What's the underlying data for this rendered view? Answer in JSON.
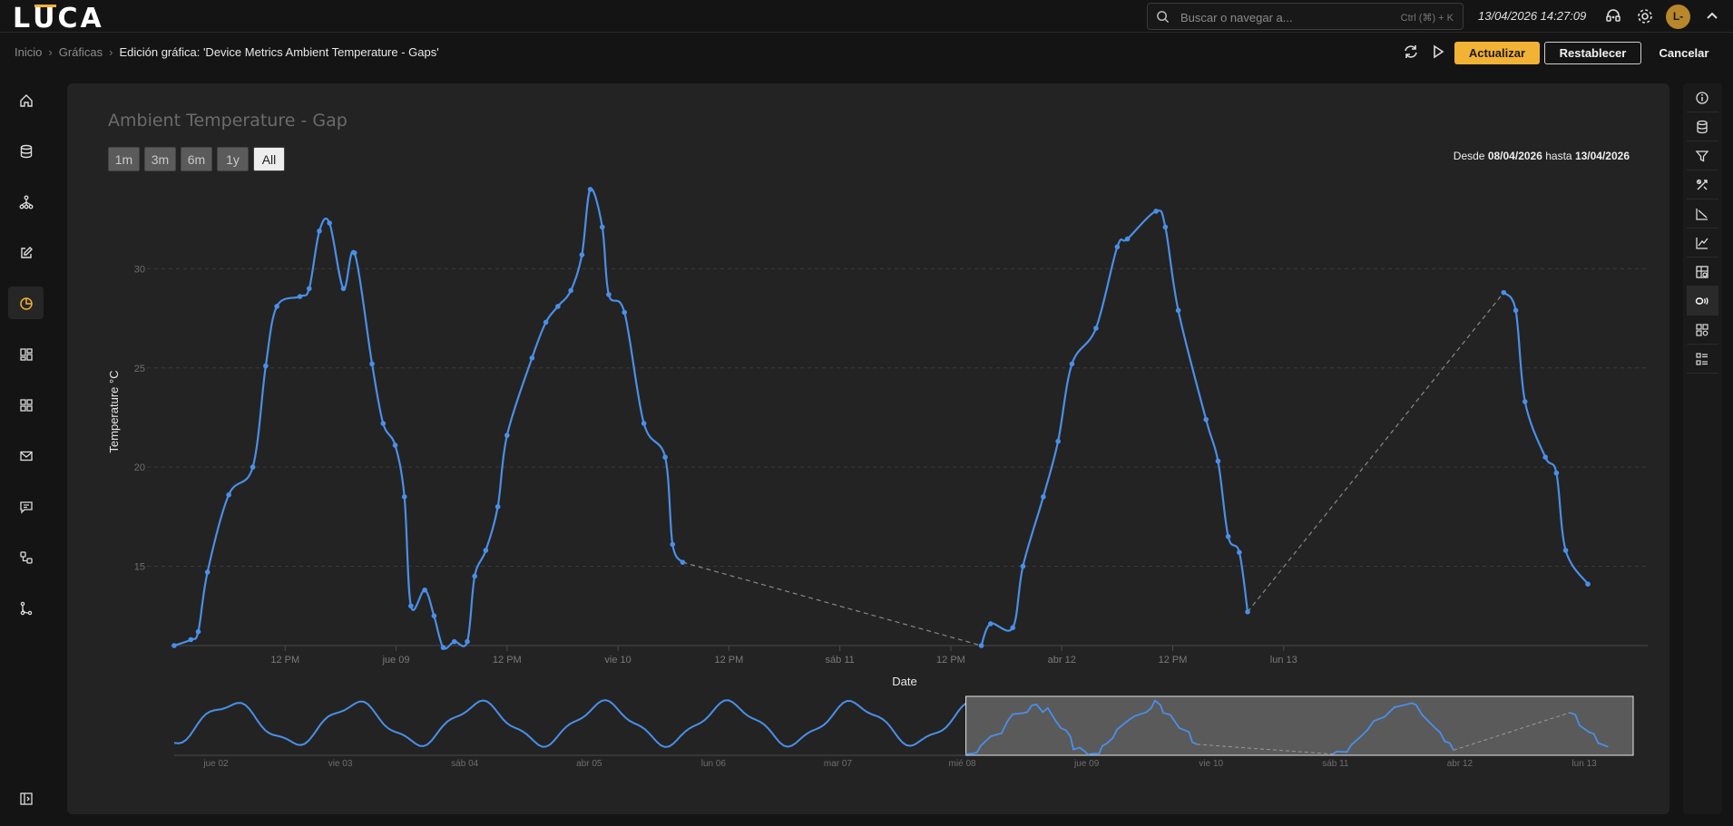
{
  "app": {
    "logo": "LUCA"
  },
  "search": {
    "placeholder": "Buscar o navegar a...",
    "shortcut": "Ctrl (⌘) + K"
  },
  "header": {
    "datetime": "13/04/2026 14:27:09",
    "avatar_initials": "L-"
  },
  "breadcrumb": {
    "items": [
      "Inicio",
      "Gráficas"
    ],
    "current": "Edición gráfica: 'Device Metrics Ambient Temperature - Gaps'"
  },
  "toolbar": {
    "update_label": "Actualizar",
    "reset_label": "Restablecer",
    "cancel_label": "Cancelar"
  },
  "sidebar": {
    "icons": [
      "home-icon",
      "database-icon",
      "network-icon",
      "edit-icon",
      "chart-pie-icon",
      "dashboard-icon",
      "grid-icon",
      "mail-icon",
      "chat-icon",
      "workflow-icon",
      "branch-icon"
    ],
    "active_index": 4,
    "footer_icon": "collapse-sidebar-icon"
  },
  "rightbar": {
    "icons": [
      "info-icon",
      "database-icon",
      "filter-icon",
      "tools-icon",
      "axis-icon",
      "line-chart-icon",
      "chart-search-icon",
      "labels-icon",
      "chart-settings-icon",
      "list-icon"
    ],
    "active_index": 7
  },
  "chart": {
    "title": "Ambient Temperature - Gap",
    "range_buttons": [
      "1m",
      "3m",
      "6m",
      "1y",
      "All"
    ],
    "selected_range": "All",
    "range_from_label": "Desde",
    "range_from": "08/04/2026",
    "range_to_label": "hasta",
    "range_to": "13/04/2026",
    "line_color": "#4a8fe8",
    "gap_color": "#888888"
  },
  "chart_data": {
    "type": "line",
    "title": "Ambient Temperature - Gap",
    "xlabel": "Date",
    "ylabel": "Temperature °C",
    "ylim": [
      11,
      35
    ],
    "y_ticks": [
      15,
      20,
      25,
      30
    ],
    "x_ticks": [
      "12 PM",
      "jue 09",
      "12 PM",
      "vie 10",
      "12 PM",
      "sáb 11",
      "12 PM",
      "abr 12",
      "12 PM",
      "lun 13"
    ],
    "grid": true,
    "legend": "none",
    "x_unit": "hours since 2026-04-08 00:00",
    "series": [
      {
        "name": "Ambient Temperature",
        "points": [
          [
            0.0,
            11.0
          ],
          [
            1.8,
            11.3
          ],
          [
            2.6,
            11.7
          ],
          [
            3.6,
            14.7
          ],
          [
            5.9,
            18.6
          ],
          [
            8.5,
            20.0
          ],
          [
            9.9,
            25.1
          ],
          [
            11.1,
            28.1
          ],
          [
            13.6,
            28.6
          ],
          [
            14.6,
            29.0
          ],
          [
            15.7,
            31.9
          ],
          [
            16.8,
            32.3
          ],
          [
            18.3,
            29.0
          ],
          [
            19.5,
            30.8
          ],
          [
            21.4,
            25.2
          ],
          [
            22.6,
            22.2
          ],
          [
            23.9,
            21.1
          ],
          [
            24.9,
            18.5
          ],
          [
            25.6,
            13.0
          ],
          [
            27.1,
            13.8
          ],
          [
            28.1,
            12.5
          ],
          [
            29.1,
            10.9
          ],
          [
            30.3,
            11.2
          ],
          [
            31.7,
            11.2
          ],
          [
            32.5,
            14.5
          ],
          [
            33.7,
            15.8
          ],
          [
            35.0,
            18.0
          ],
          [
            36.0,
            21.6
          ],
          [
            38.7,
            25.5
          ],
          [
            40.2,
            27.3
          ],
          [
            41.5,
            28.1
          ],
          [
            42.9,
            28.9
          ],
          [
            44.1,
            30.7
          ],
          [
            45.0,
            34.0
          ],
          [
            46.3,
            32.1
          ],
          [
            47.0,
            28.7
          ],
          [
            48.7,
            27.8
          ],
          [
            50.8,
            22.2
          ],
          [
            53.1,
            20.5
          ],
          [
            53.9,
            16.1
          ],
          [
            55.0,
            15.2
          ]
        ],
        "gap_after_index": 40,
        "points_2": [
          [
            87.3,
            11.0
          ],
          [
            88.3,
            12.1
          ],
          [
            90.7,
            11.9
          ],
          [
            91.8,
            15.0
          ],
          [
            94.0,
            18.5
          ],
          [
            95.6,
            21.3
          ],
          [
            97.1,
            25.2
          ],
          [
            99.7,
            27.0
          ],
          [
            102.0,
            31.1
          ],
          [
            103.1,
            31.5
          ],
          [
            106.2,
            32.9
          ],
          [
            107.2,
            32.1
          ],
          [
            108.6,
            27.9
          ],
          [
            111.6,
            22.4
          ],
          [
            112.9,
            20.3
          ],
          [
            114.0,
            16.5
          ],
          [
            115.2,
            15.7
          ],
          [
            116.1,
            12.7
          ]
        ],
        "points_3": [
          [
            143.8,
            28.8
          ],
          [
            145.1,
            27.9
          ],
          [
            146.1,
            23.3
          ],
          [
            148.3,
            20.5
          ],
          [
            149.5,
            19.7
          ],
          [
            150.5,
            15.8
          ],
          [
            152.9,
            14.1
          ]
        ]
      }
    ],
    "navigator": {
      "x_ticks": [
        "jue 02",
        "vie 03",
        "sáb 04",
        "abr 05",
        "lun 06",
        "mar 07",
        "mié 08",
        "jue 09",
        "vie 10",
        "sáb 11",
        "abr 12",
        "lun 13"
      ],
      "selection_start": "mié 08",
      "selection_end": "lun 13"
    }
  }
}
